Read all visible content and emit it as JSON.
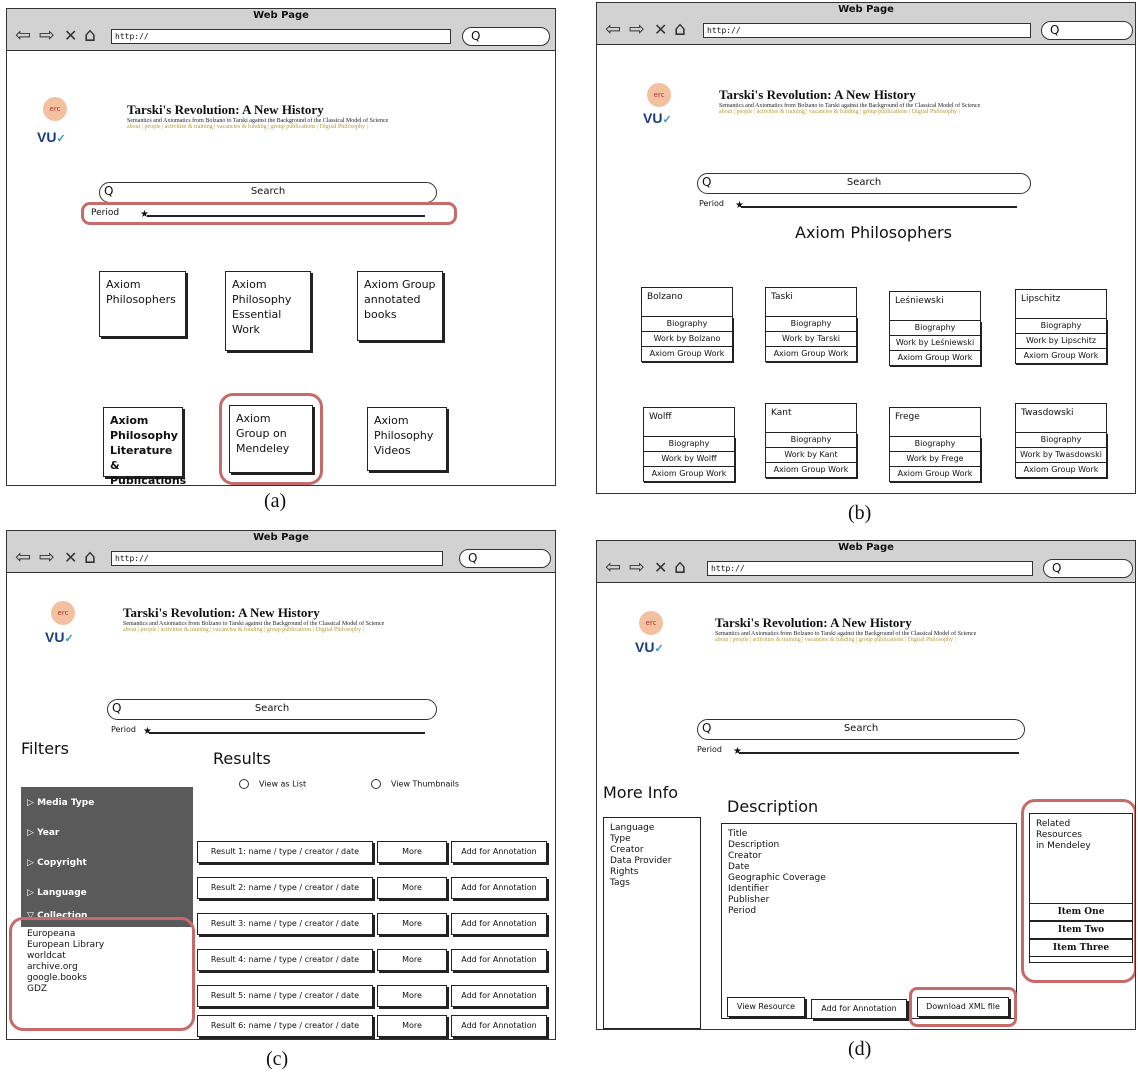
{
  "common": {
    "window_title": "Web Page",
    "url": "http://",
    "browser_search_glyph": "Q",
    "site_title": "Tarski's Revolution: A New History",
    "site_subtitle": "Semantics and Axiomatics from Bolzano to Tarski against the Background of the Classical Model of Science",
    "site_links": "about | people | activities & training | vacancies & funding | group publications | Digital Philosophy |",
    "logo_erc": "erc",
    "logo_vu": "VU",
    "search_label": "Search",
    "period_label": "Period",
    "icons": [
      "back-arrow-icon",
      "forward-arrow-icon",
      "close-x-icon",
      "home-icon",
      "magnifier-icon",
      "slider-knob-icon",
      "triangle-right-icon",
      "radio-circle-icon"
    ]
  },
  "captions": {
    "a": "(a)",
    "b": "(b)",
    "c": "(c)",
    "d": "(d)"
  },
  "panel_a": {
    "tiles": [
      "Axiom Philosophers",
      "Axiom Philosophy Essential Work",
      "Axiom Group annotated books",
      "Axiom Philosophy Literature & Publications",
      "Axiom Group on Mendeley",
      "Axiom Philosophy Videos"
    ]
  },
  "panel_b": {
    "heading": "Axiom Philosophers",
    "philosophers": [
      {
        "name": "Bolzano",
        "bio": "Biography",
        "work": "Work by Bolzano",
        "group": "Axiom Group Work"
      },
      {
        "name": "Taski",
        "bio": "Biography",
        "work": "Work by Tarski",
        "group": "Axiom Group Work"
      },
      {
        "name": "Leśniewski",
        "bio": "Biography",
        "work": "Work by Leśniewski",
        "group": "Axiom Group Work"
      },
      {
        "name": "Lipschitz",
        "bio": "Biography",
        "work": "Work by Lipschitz",
        "group": "Axiom Group Work"
      },
      {
        "name": "Wolff",
        "bio": "Biography",
        "work": "Work by Wolff",
        "group": "Axiom Group Work"
      },
      {
        "name": "Kant",
        "bio": "Biography",
        "work": "Work by Kant",
        "group": "Axiom Group Work"
      },
      {
        "name": "Frege",
        "bio": "Biography",
        "work": "Work by Frege",
        "group": "Axiom Group Work"
      },
      {
        "name": "Twasdowski",
        "bio": "Biography",
        "work": "Work by Twasdowski",
        "group": "Axiom Group Work"
      }
    ]
  },
  "panel_c": {
    "filters_title": "Filters",
    "results_title": "Results",
    "view_list": "View as List",
    "view_thumbs": "View Thumbnails",
    "filter_headers": [
      "Media Type",
      "Year",
      "Copyright",
      "Language",
      "Collection"
    ],
    "collections": [
      "Europeana",
      "European Library",
      "worldcat",
      "archive.org",
      "google.books",
      "GDZ"
    ],
    "results": [
      "Result 1: name / type / creator / date",
      "Result 2: name / type / creator / date",
      "Result 3: name / type / creator / date",
      "Result 4: name / type / creator / date",
      "Result 5: name / type / creator / date",
      "Result 6: name / type / creator / date"
    ],
    "more_label": "More",
    "annotate_label": "Add for Annotation"
  },
  "panel_d": {
    "more_info_title": "More Info",
    "more_info_items": "Language\nType\nCreator\nData Provider\nRights\nTags",
    "description_title": "Description",
    "description_items": "Title\nDescription\nCreator\nDate\nGeographic Coverage\nIdentifier\nPublisher\nPeriod",
    "related_label": "Related\nResources\nin Mendeley",
    "related_items": [
      "Item One",
      "Item Two",
      "Item Three"
    ],
    "btn_view": "View Resource",
    "btn_annotate": "Add for Annotation",
    "btn_download": "Download XML file"
  }
}
